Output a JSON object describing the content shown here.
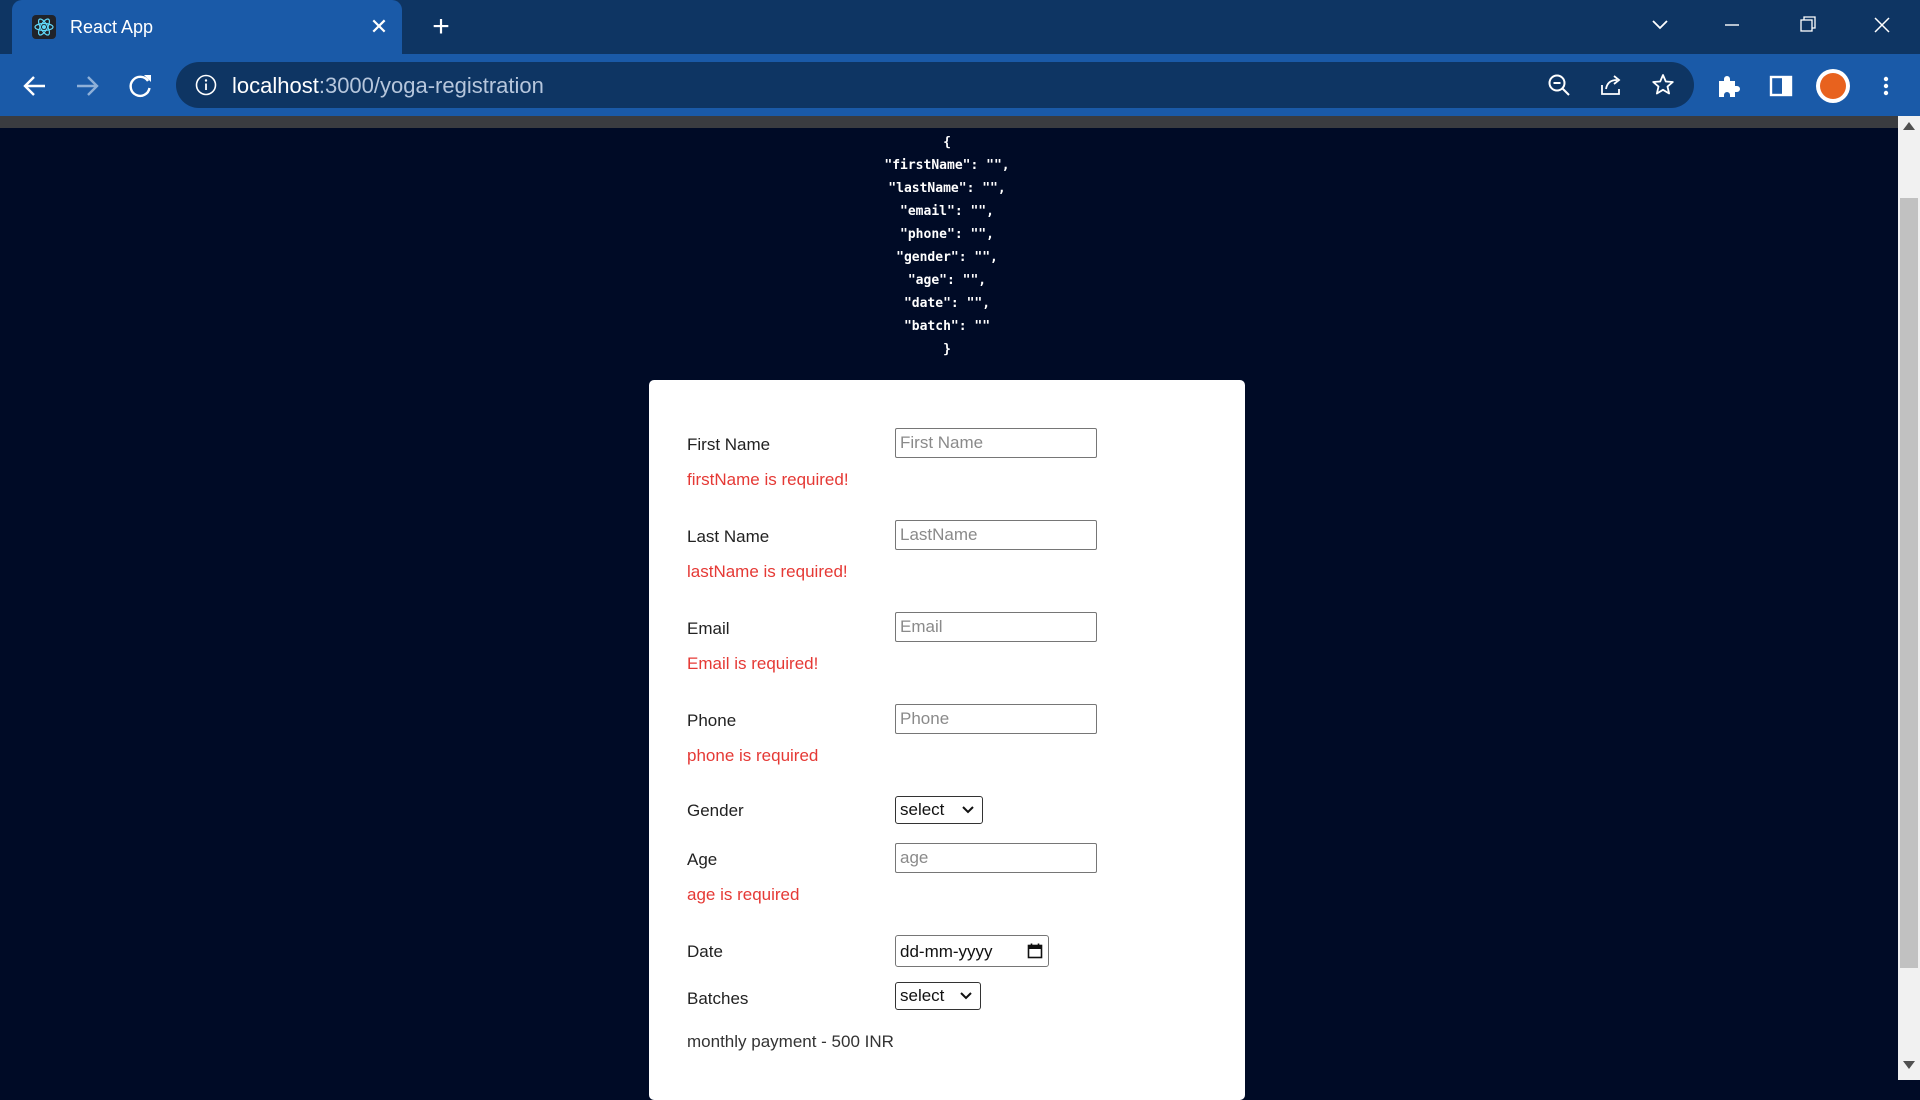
{
  "browser": {
    "tab_title": "React App",
    "url_host": "localhost",
    "url_path": ":3000/yoga-registration"
  },
  "json_dump": {
    "lines": [
      "{",
      "\"firstName\": \"\",",
      "\"lastName\": \"\",",
      "\"email\": \"\",",
      "\"phone\": \"\",",
      "\"gender\": \"\",",
      "\"age\": \"\",",
      "\"date\": \"\",",
      "\"batch\": \"\"",
      "}"
    ]
  },
  "form": {
    "first_name": {
      "label": "First Name",
      "placeholder": "First Name",
      "value": "",
      "error": "firstName is required!"
    },
    "last_name": {
      "label": "Last Name",
      "placeholder": "LastName",
      "value": "",
      "error": "lastName is required!"
    },
    "email": {
      "label": "Email",
      "placeholder": "Email",
      "value": "",
      "error": "Email is required!"
    },
    "phone": {
      "label": "Phone",
      "placeholder": "Phone",
      "value": "",
      "error": "phone is required"
    },
    "gender": {
      "label": "Gender",
      "selected": "select"
    },
    "age": {
      "label": "Age",
      "placeholder": "age",
      "value": "",
      "error": "age is required"
    },
    "date": {
      "label": "Date",
      "value": "dd-mm-yyyy"
    },
    "batches": {
      "label": "Batches",
      "selected": "select"
    },
    "payment_text": "monthly payment - 500 INR"
  },
  "colors": {
    "page_background": "#000b26",
    "error": "#e53935",
    "chrome_tab": "#1a5aa8",
    "chrome_frame": "#0e3563"
  },
  "icons": [
    "react-logo-icon",
    "close-icon",
    "plus-icon",
    "chevron-down-icon",
    "minimize-icon",
    "restore-icon",
    "window-close-icon",
    "back-arrow-icon",
    "forward-arrow-icon",
    "reload-icon",
    "info-icon",
    "zoom-icon",
    "share-icon",
    "star-icon",
    "extensions-icon",
    "side-panel-icon",
    "profile-avatar",
    "menu-icon",
    "calendar-icon"
  ]
}
